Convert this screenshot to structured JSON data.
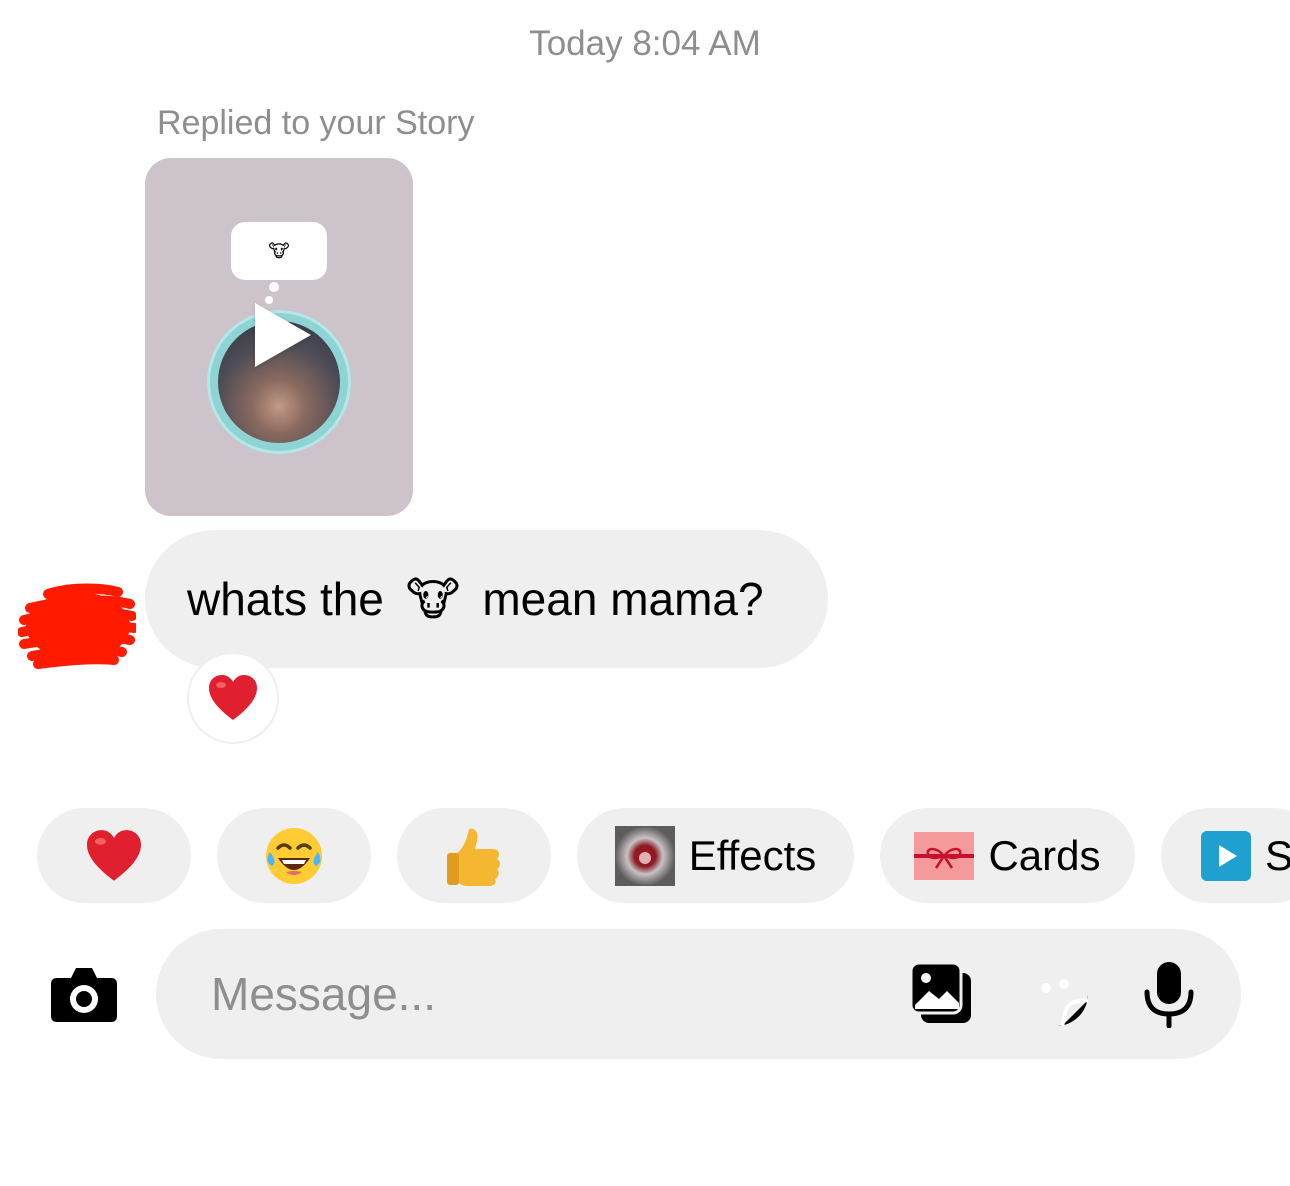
{
  "thread": {
    "timestamp": "Today 8:04 AM",
    "reply_context": "Replied to your Story",
    "story_sticker_emoji": "🐮"
  },
  "message": {
    "text_before": "whats the",
    "emoji": "🐮",
    "text_after": "mean mama?",
    "reaction": "❤️"
  },
  "quick_reactions": [
    {
      "name": "heart",
      "glyph": "❤️"
    },
    {
      "name": "laughing",
      "glyph": "😂"
    },
    {
      "name": "thumbs-up",
      "glyph": "👍"
    }
  ],
  "chips": {
    "effects_label": "Effects",
    "cards_label": "Cards",
    "third_label": "S"
  },
  "composer": {
    "placeholder": "Message..."
  },
  "icons": {
    "camera": "camera-icon",
    "gallery": "gallery-icon",
    "sticker": "sticker-icon",
    "mic": "microphone-icon",
    "play": "play-icon"
  },
  "colors": {
    "bubble_bg": "#efefef",
    "secondary_text": "#8e8e8e",
    "heart_red": "#e0202e",
    "avatar_redaction": "#ff1a00",
    "cards_pink": "#f49a9a",
    "video_blue": "#1ea0d0"
  }
}
